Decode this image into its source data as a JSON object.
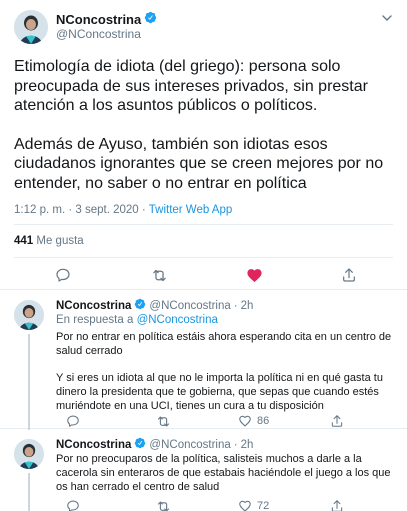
{
  "colors": {
    "accent": "#1da1f2",
    "link": "#1b95e0",
    "muted": "#657786",
    "text": "#14171a",
    "like_active": "#e0245e",
    "border": "#e6ecf0"
  },
  "main_tweet": {
    "display_name": "NConcostrina",
    "handle": "@NConcostrina",
    "verified_icon": "verified-badge-icon",
    "menu_icon": "chevron-down-icon",
    "paragraphs": [
      "Etimología de idiota (del griego): persona solo preocupada de sus intereses privados, sin prestar atención a los asuntos públicos o políticos.",
      "Además de Ayuso, también son idiotas esos ciudadanos ignorantes que se creen mejores por no entender, no saber o no entrar en política"
    ],
    "time": "1:12 p. m.",
    "separator": "·",
    "date": "3 sept. 2020",
    "source": "Twitter Web App",
    "likes_count": "441",
    "likes_label": "Me gusta",
    "actions": {
      "reply_icon": "reply-icon",
      "retweet_icon": "retweet-icon",
      "like_icon": "heart-filled-icon",
      "share_icon": "share-icon"
    }
  },
  "replies": [
    {
      "display_name": "NConcostrina",
      "handle": "@NConcostrina",
      "dot": "·",
      "age": "2h",
      "in_reply_prefix": "En respuesta a",
      "in_reply_to": "@NConcostrina",
      "paragraphs": [
        "Por no entrar en política estáis ahora esperando cita en un centro de salud cerrado",
        "Y si eres un idiota al que no le importa la política ni en qué gasta tu dinero la presidenta que te gobierna, que sepas que cuando estés muriéndote en una UCI, tienes un cura a tu disposición"
      ],
      "likes": "86"
    },
    {
      "display_name": "NConcostrina",
      "handle": "@NConcostrina",
      "dot": "·",
      "age": "2h",
      "paragraphs": [
        "Por no preocuparos de la política, salisteis muchos a darle a la cacerola sin enteraros de que estabais haciéndole el juego a los que os han cerrado el centro de salud"
      ],
      "likes": "72"
    }
  ]
}
